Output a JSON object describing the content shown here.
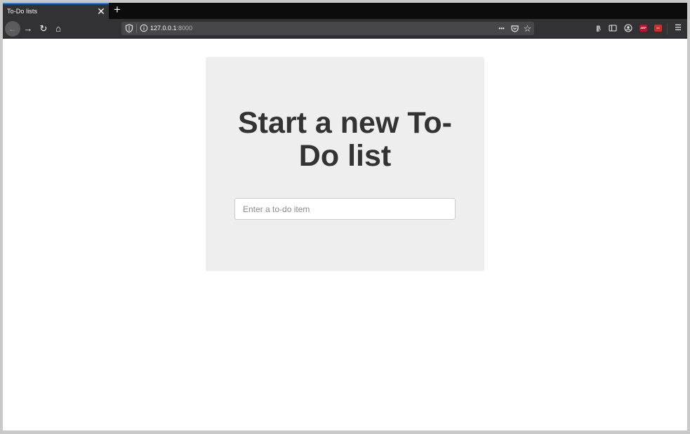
{
  "browser": {
    "tab": {
      "title": "To-Do lists",
      "close_glyph": "✕"
    },
    "new_tab_glyph": "+",
    "nav": {
      "back_glyph": "←",
      "forward_glyph": "→",
      "reload_glyph": "↻",
      "home_glyph": "⌂"
    },
    "url": {
      "host": "127.0.0.1",
      "port": ":8000"
    },
    "url_actions": {
      "page_actions_glyph": "•••",
      "pocket_glyph": "◡",
      "bookmark_glyph": "☆"
    },
    "toolbar": {
      "library_glyph": "|||\\",
      "sidebar_glyph": "▭",
      "account_glyph": "◉",
      "menu_glyph": "☰",
      "ext_abp_label": "ABP",
      "ext_lastpass_label": "•••"
    },
    "colors": {
      "accent": "#0a84ff",
      "ext_abp": "#c70d2c",
      "ext_lastpass": "#d32d27"
    }
  },
  "page": {
    "heading": "Start a new To-Do list",
    "input": {
      "placeholder": "Enter a to-do item",
      "value": ""
    }
  }
}
